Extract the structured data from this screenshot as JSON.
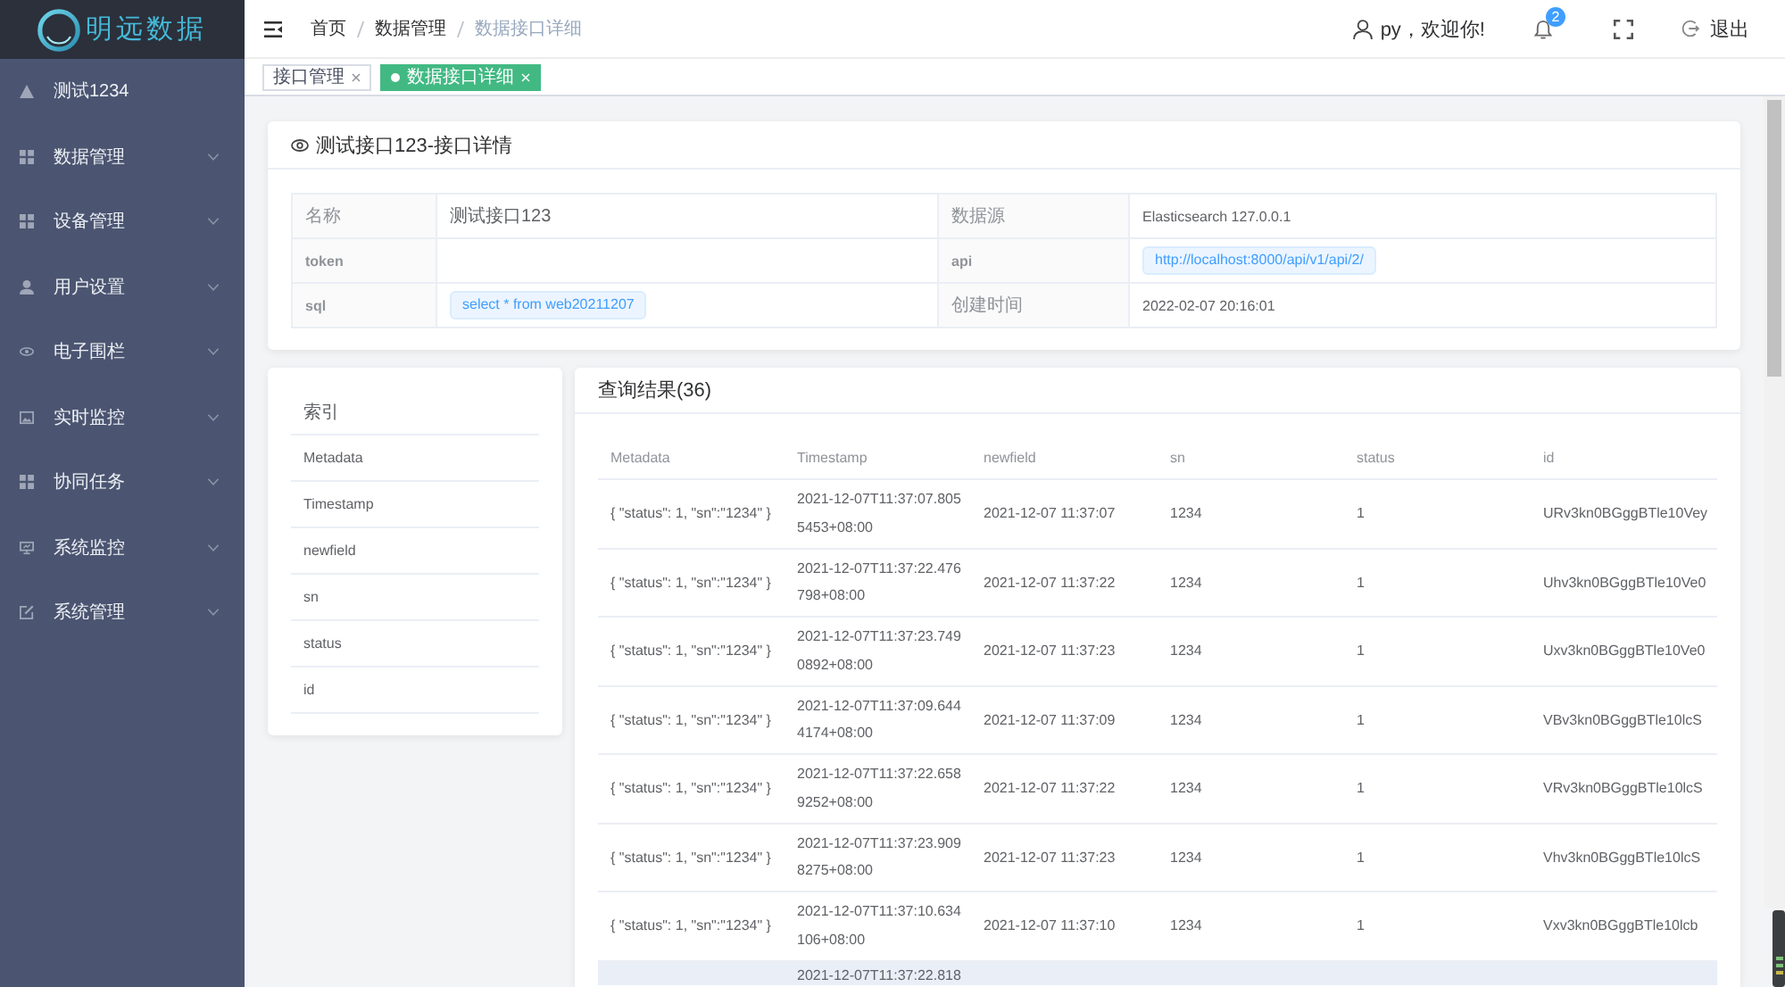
{
  "sidebar": {
    "logo": "明远数据",
    "items": [
      {
        "label": "测试1234",
        "kind": "link"
      },
      {
        "label": "数据管理",
        "kind": "submenu",
        "expanded": false
      },
      {
        "label": "设备管理",
        "kind": "submenu",
        "expanded": false
      },
      {
        "label": "用户设置",
        "kind": "submenu",
        "expanded": false
      },
      {
        "label": "电子围栏",
        "kind": "submenu",
        "expanded": false
      },
      {
        "label": "实时监控",
        "kind": "submenu",
        "expanded": false
      },
      {
        "label": "协同任务",
        "kind": "submenu",
        "expanded": false
      },
      {
        "label": "系统监控",
        "kind": "submenu",
        "expanded": false
      },
      {
        "label": "系统管理",
        "kind": "submenu",
        "expanded": false
      }
    ]
  },
  "header": {
    "breadcrumb": [
      {
        "label": "首页",
        "current": false
      },
      {
        "label": "数据管理",
        "current": false
      },
      {
        "label": "数据接口详细",
        "current": true
      }
    ],
    "user": "py，欢迎你!",
    "notification_badge": "2",
    "logout": "退出"
  },
  "tabs": [
    {
      "label": "接口管理",
      "selected": false
    },
    {
      "label": "数据接口详细",
      "selected": true
    }
  ],
  "detail_card": {
    "title": "测试接口123-接口详情",
    "fields": [
      {
        "label": "名称",
        "value": "测试接口123",
        "kind": "text"
      },
      {
        "label": "数据源",
        "value": "Elasticsearch 127.0.0.1",
        "kind": "text"
      },
      {
        "label": "token",
        "kind": "text"
      },
      {
        "label": "api",
        "value": "http://localhost:8000/api/v1/api/2/",
        "kind": "tag"
      },
      {
        "label": "sql",
        "value": "select * from web20211207",
        "kind": "tag"
      },
      {
        "label": "创建时间",
        "value": "2022-02-07 20:16:01",
        "kind": "text"
      }
    ]
  },
  "index_card": {
    "heading": "索引",
    "fields": [
      "Metadata",
      "Timestamp",
      "newfield",
      "sn",
      "status",
      "id"
    ]
  },
  "results_card": {
    "title": "查询结果(36)",
    "table": {
      "columns": [
        "Metadata",
        "Timestamp",
        "newfield",
        "sn",
        "status",
        "id"
      ],
      "rows": [
        {
          "metadata": "{ \"status\": 1, \"sn\":\"1234\" }",
          "timestamp": "2021-12-07T11:37:07.8055453+08:00",
          "newfield": "2021-12-07 11:37:07",
          "sn": "1234",
          "status": "1",
          "id": "URv3kn0BGggBTle10Vey",
          "hovered": false
        },
        {
          "metadata": "{ \"status\": 1, \"sn\":\"1234\" }",
          "timestamp": "2021-12-07T11:37:22.476798+08:00",
          "newfield": "2021-12-07 11:37:22",
          "sn": "1234",
          "status": "1",
          "id": "Uhv3kn0BGggBTle10Ve0",
          "hovered": false
        },
        {
          "metadata": "{ \"status\": 1, \"sn\":\"1234\" }",
          "timestamp": "2021-12-07T11:37:23.7490892+08:00",
          "newfield": "2021-12-07 11:37:23",
          "sn": "1234",
          "status": "1",
          "id": "Uxv3kn0BGggBTle10Ve0",
          "hovered": false
        },
        {
          "metadata": "{ \"status\": 1, \"sn\":\"1234\" }",
          "timestamp": "2021-12-07T11:37:09.6444174+08:00",
          "newfield": "2021-12-07 11:37:09",
          "sn": "1234",
          "status": "1",
          "id": "VBv3kn0BGggBTle10lcS",
          "hovered": false
        },
        {
          "metadata": "{ \"status\": 1, \"sn\":\"1234\" }",
          "timestamp": "2021-12-07T11:37:22.6589252+08:00",
          "newfield": "2021-12-07 11:37:22",
          "sn": "1234",
          "status": "1",
          "id": "VRv3kn0BGggBTle10lcS",
          "hovered": false
        },
        {
          "metadata": "{ \"status\": 1, \"sn\":\"1234\" }",
          "timestamp": "2021-12-07T11:37:23.9098275+08:00",
          "newfield": "2021-12-07 11:37:23",
          "sn": "1234",
          "status": "1",
          "id": "Vhv3kn0BGggBTle10lcS",
          "hovered": false
        },
        {
          "metadata": "{ \"status\": 1, \"sn\":\"1234\" }",
          "timestamp": "2021-12-07T11:37:10.634106+08:00",
          "newfield": "2021-12-07 11:37:10",
          "sn": "1234",
          "status": "1",
          "id": "Vxv3kn0BGggBTle10lcb",
          "hovered": false
        },
        {
          "timestamp": "2021-12-07T11:37:22.818",
          "hovered": true
        }
      ]
    }
  }
}
